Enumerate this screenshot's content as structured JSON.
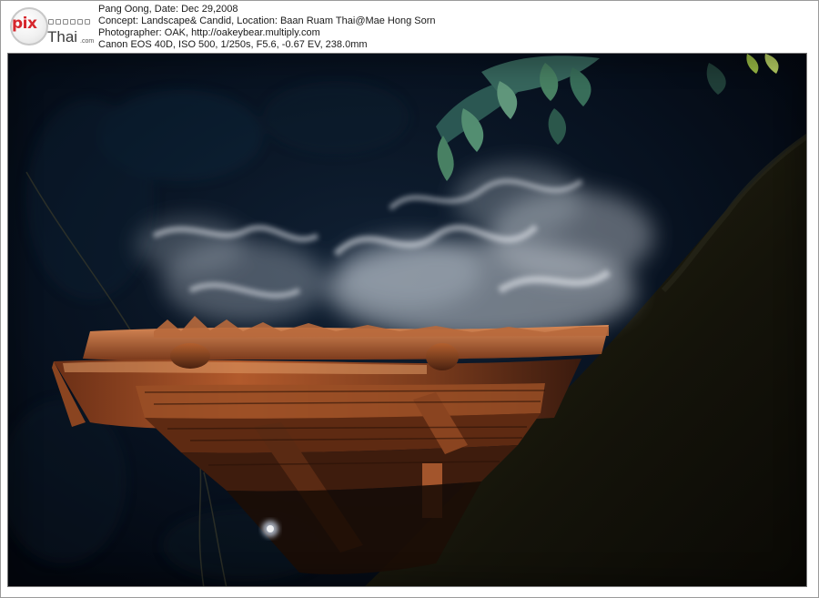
{
  "header": {
    "logo": {
      "pix": "pix",
      "thai": "Thai",
      "com": ".com"
    },
    "info_lines": [
      "Pang Oong, Date: Dec 29,2008",
      "Concept: Landscape& Candid, Location: Baan Ruam Thai@Mae Hong Sorn",
      "Photographer: OAK, http://oakeybear.multiply.com",
      "Canon EOS 40D, ISO 500, 1/250s, F5.6, -0.67 EV, 238.0mm"
    ]
  },
  "photo": {
    "subject": "steam-rising-from-thatched-roof",
    "colors": {
      "background": "#050b17",
      "roof_light": "#c46a3c",
      "roof_dark": "#3a1a0e",
      "steam": "#e8ecf2",
      "foliage": "#4f8c6a"
    }
  }
}
